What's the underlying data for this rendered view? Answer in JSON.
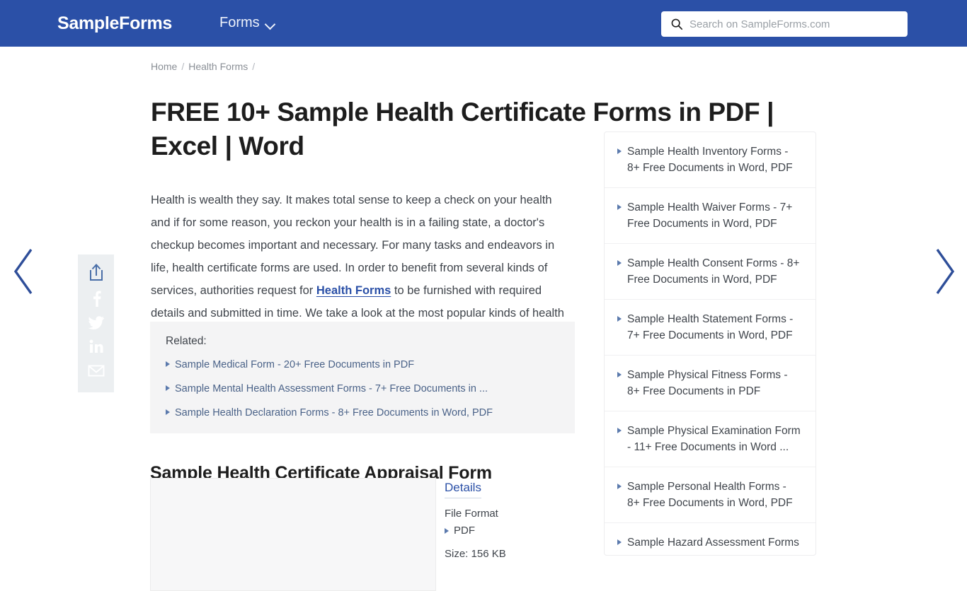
{
  "header": {
    "brand": "SampleForms",
    "nav_label": "Forms",
    "search_placeholder": "Search on SampleForms.com",
    "search_value": "",
    "bg_color": "#2b50a7"
  },
  "nav_arrows": {
    "prev": "previous-article",
    "next": "next-article"
  },
  "share_rail": {
    "items": [
      {
        "name": "share-icon",
        "label": "Share"
      },
      {
        "name": "facebook-icon",
        "label": "Facebook"
      },
      {
        "name": "twitter-icon",
        "label": "Twitter"
      },
      {
        "name": "linkedin-icon",
        "label": "LinkedIn"
      },
      {
        "name": "email-icon",
        "label": "Email"
      }
    ]
  },
  "breadcrumb": {
    "home": "Home",
    "sep1": "/",
    "category": "Health Forms",
    "sep2": "/"
  },
  "main": {
    "title": "FREE 10+ Sample Health Certificate Forms in PDF | Excel | Word",
    "paragraph_part1": "Health is wealth they say. It makes total sense to keep a check on your health and if for some reason, you reckon your health is in a failing state, a doctor's checkup becomes important and necessary. For many tasks and endeavors in life, health certificate forms are used. In order to benefit from several kinds of services, authorities request for ",
    "paragraph_link": "Health Forms",
    "paragraph_part2": " to be furnished with required details and submitted in time. We take a look at the most popular kinds of health certificate forms.",
    "related_title": "Related:",
    "related_links": [
      "Sample Medical Form - 20+ Free Documents in PDF",
      "Sample Mental Health Assessment Forms - 7+ Free Documents in ...",
      "Sample Health Declaration Forms - 8+ Free Documents in Word, PDF"
    ],
    "section_title": "Sample Health Certificate Appraisal Form",
    "details": {
      "heading": "Details",
      "file_format_label": "File Format",
      "file_format_value": "PDF",
      "size": "Size: 156 KB"
    }
  },
  "sidebar": {
    "items": [
      "Sample Health Inventory Forms - 8+ Free Documents in Word, PDF",
      "Sample Health Waiver Forms - 7+ Free Documents in Word, PDF",
      "Sample Health Consent Forms - 8+ Free Documents in Word, PDF",
      "Sample Health Statement Forms - 7+ Free Documents in Word, PDF",
      "Sample Physical Fitness Forms - 8+ Free Documents in PDF",
      "Sample Physical Examination Form - 11+ Free Documents in Word ...",
      "Sample Personal Health Forms - 8+ Free Documents in Word, PDF",
      "Sample Hazard Assessment Forms"
    ]
  },
  "colors": {
    "brand_blue": "#2b50a7",
    "link_blue": "#4a6288",
    "text_dark": "#3f444b",
    "muted": "#8a8f96"
  }
}
